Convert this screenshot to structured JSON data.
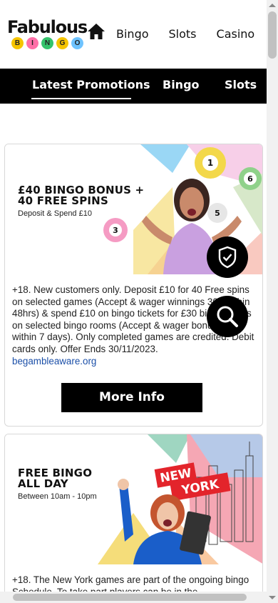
{
  "brand": {
    "word": "Fabulous",
    "balls": [
      {
        "letter": "B",
        "color": "#f5c400"
      },
      {
        "letter": "I",
        "color": "#ff6fa8"
      },
      {
        "letter": "N",
        "color": "#34c36b"
      },
      {
        "letter": "G",
        "color": "#f5c400"
      },
      {
        "letter": "O",
        "color": "#6ec3ff"
      }
    ]
  },
  "top_nav": {
    "home_icon": "home-icon",
    "items": [
      "Bingo",
      "Slots",
      "Casino"
    ]
  },
  "promo_nav": {
    "tabs": [
      "Latest Promotions",
      "Bingo",
      "Slots"
    ],
    "active": "Latest Promotions"
  },
  "promotions": [
    {
      "banner_title_line1": "£40 BINGO BONUS +",
      "banner_title_line2": "40 FREE SPINS",
      "banner_subtitle": "Deposit & Spend £10",
      "terms": "+18. New customers only. Deposit £10 for 40 Free spins on selected games (Accept & wager winnings 30x within 48hrs) & spend £10 on bingo tickets for £30 bingo bonus on selected bingo rooms (Accept & wager bonus 3x within 7 days). Only completed games are credited. Debit cards only. Offer Ends 30/11/2023.",
      "link": "begambleaware.org",
      "button": "More Info",
      "ball_numbers": [
        "1",
        "6",
        "3",
        "5"
      ]
    },
    {
      "banner_title_line1": "FREE BINGO",
      "banner_title_line2": "ALL DAY",
      "banner_subtitle": "Between 10am - 10pm",
      "sign_top": "NEW",
      "sign_bottom": "YORK",
      "terms": "+18. The New York games are part of the ongoing bingo Schedule. To take part players can be in the"
    }
  ],
  "floating": {
    "shield_icon": "shield-check-icon",
    "search_icon": "search-icon"
  },
  "colors": {
    "black": "#000000",
    "link": "#1b4fa8",
    "sign_red": "#e3242b"
  }
}
